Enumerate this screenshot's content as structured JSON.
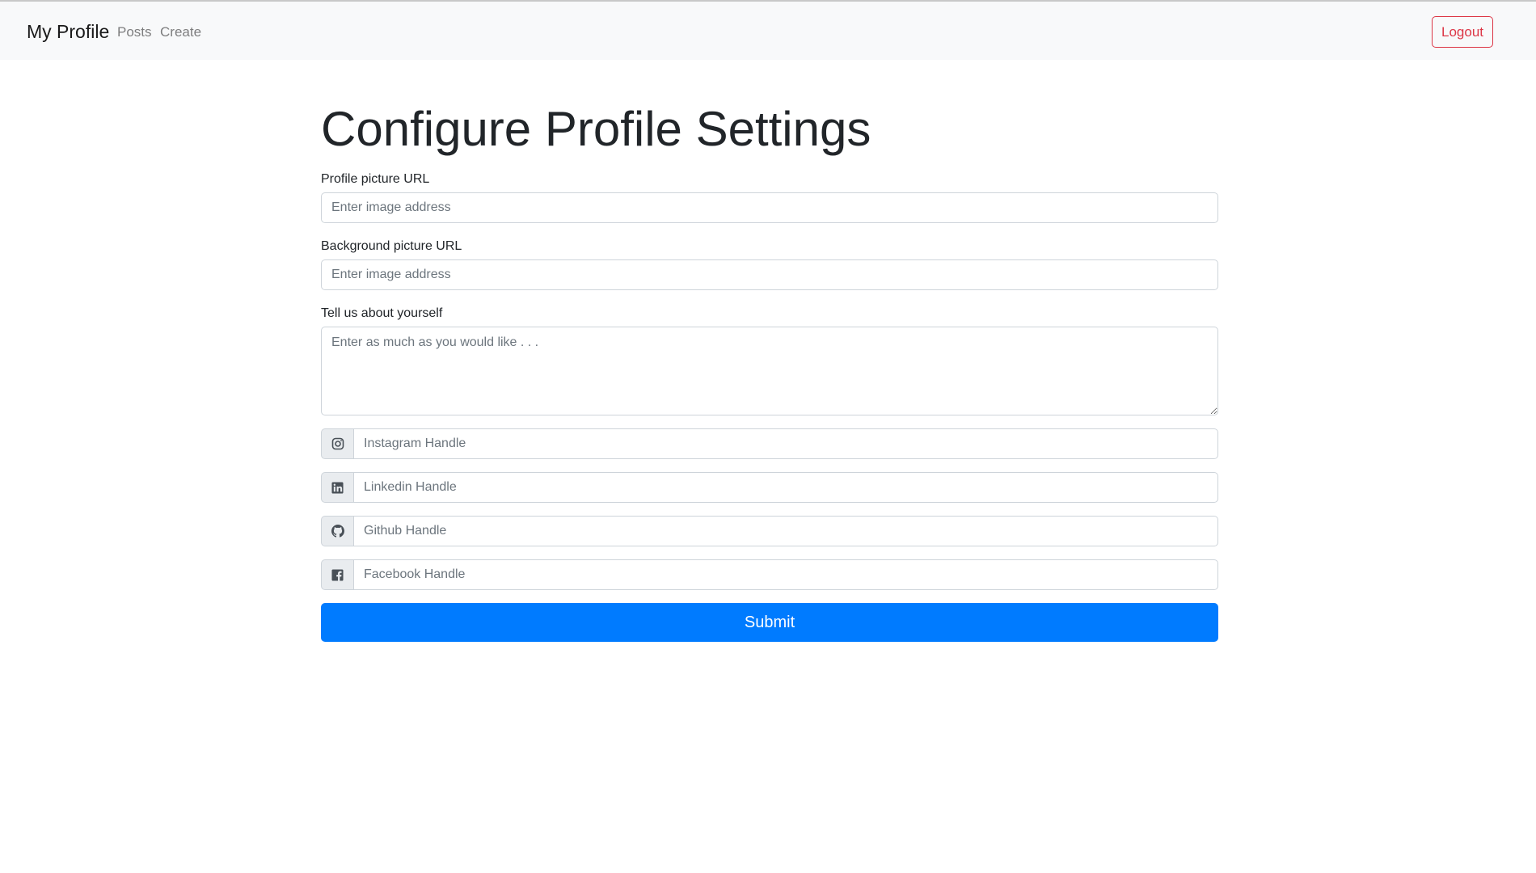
{
  "navbar": {
    "brand": "My Profile",
    "links": [
      "Posts",
      "Create"
    ],
    "logout_label": "Logout"
  },
  "page": {
    "title": "Configure Profile Settings"
  },
  "form": {
    "profile_picture": {
      "label": "Profile picture URL",
      "placeholder": "Enter image address",
      "value": ""
    },
    "background_picture": {
      "label": "Background picture URL",
      "placeholder": "Enter image address",
      "value": ""
    },
    "about": {
      "label": "Tell us about yourself",
      "placeholder": "Enter as much as you would like . . .",
      "value": ""
    },
    "instagram": {
      "icon": "instagram-icon",
      "placeholder": "Instagram Handle",
      "value": ""
    },
    "linkedin": {
      "icon": "linkedin-icon",
      "placeholder": "Linkedin Handle",
      "value": ""
    },
    "github": {
      "icon": "github-icon",
      "placeholder": "Github Handle",
      "value": ""
    },
    "facebook": {
      "icon": "facebook-icon",
      "placeholder": "Facebook Handle",
      "value": ""
    },
    "submit_label": "Submit"
  },
  "colors": {
    "primary": "#007bff",
    "danger": "#dc3545",
    "navbar_bg": "#f8f9fa",
    "addon_bg": "#e9ecef",
    "border": "#ced4da"
  }
}
